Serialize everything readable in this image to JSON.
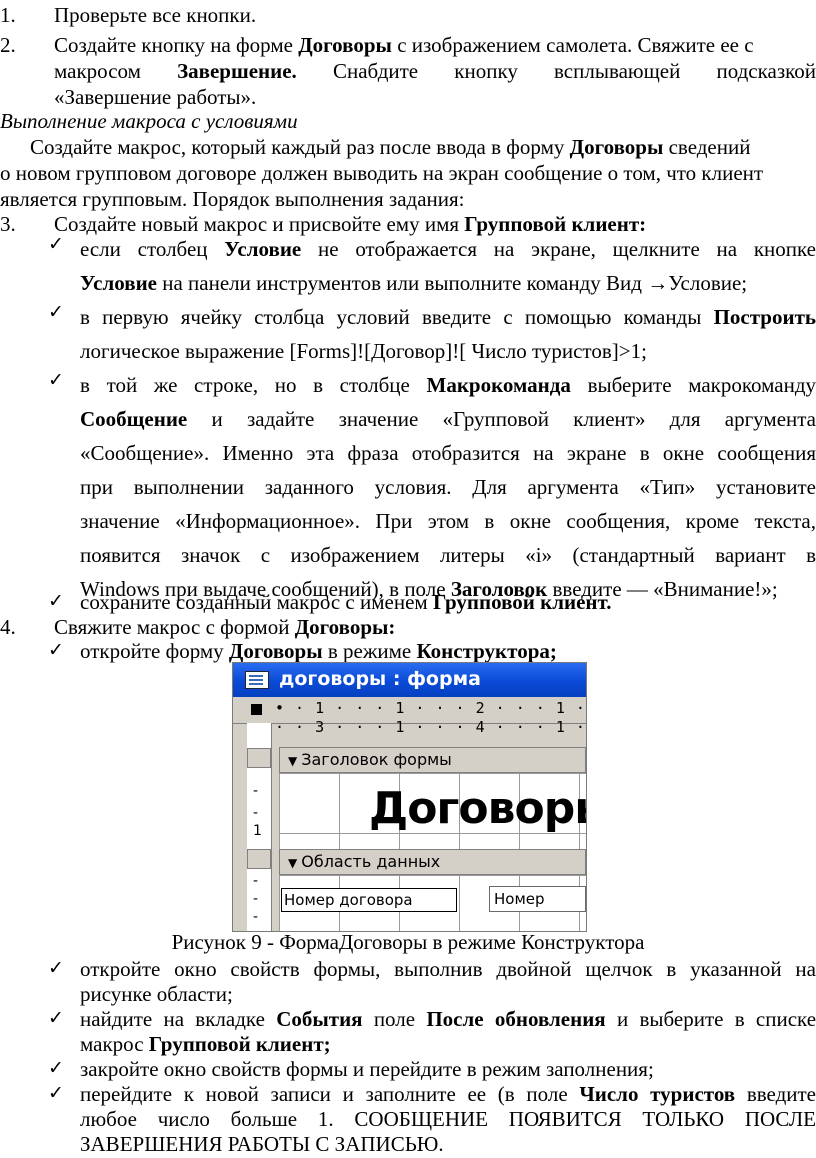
{
  "steps": [
    {
      "num": "1.",
      "text": "Проверьте все кнопки."
    },
    {
      "num": "2.",
      "l1_a": "Создайте кнопку на форме ",
      "l1_b": "Договоры",
      "l1_c": " с изображением самолета. Свяжите ее с",
      "l2_a": "макросом ",
      "l2_b": "Завершение.",
      "l2_c": " Снабдите кнопку всплывающей подсказкой",
      "l3": "«Завершение работы»."
    }
  ],
  "section_title": "Выполнение макроса с условиями",
  "intro": {
    "l1_a": "Создайте макрос, который каждый раз после ввода в форму ",
    "l1_b": "Договоры",
    "l1_c": " сведений",
    "l2": "о новом групповом договоре должен выводить на экран сообщение о том, что клиент",
    "l3": "является групповым. Порядок выполнения задания:"
  },
  "step3": {
    "num": "3.",
    "text_a": "Создайте новый макрос и присвойте ему имя ",
    "text_b": "Групповой клиент:",
    "b1": {
      "l1_a": "если столбец ",
      "l1_b": "Условие",
      "l1_c": " не отображается на экране, щелкните на кнопке",
      "l2_a": "Условие",
      "l2_c": " на панели инструментов или выполните команду Вид →Условие;"
    },
    "b2": {
      "l1_a": "в первую ячейку столбца условий введите с помощью команды ",
      "l1_b": "Построить",
      "l2": "логическое выражение [Forms]![Договор]![ Число туристов]>1;"
    },
    "b3": {
      "l1_a": "в той же строке, но в столбце ",
      "l1_b": "Макрокоманда",
      "l1_c": " выберите макрокоманду",
      "l2_b": "Сообщение",
      "l2_c": " и задайте значение «Групповой клиент» для аргумента",
      "l3": "«Сообщение». Именно эта фраза отобразится на экране в окне сообщения",
      "l4": "при выполнении заданного условия. Для аргумента «Тип» установите",
      "l5": "значение «Информационное». При этом в окне сообщения, кроме текста,",
      "l6": "появится значок с изображением литеры «i» (стандартный вариант в",
      "l7_a": "Windows при выдаче сообщений), в поле ",
      "l7_b": "Заголовок",
      "l7_c": " введите — «Внимание!»;"
    },
    "b4": {
      "a": "сохраните созданный макрос с именем ",
      "b": "Групповой клиент."
    }
  },
  "step4": {
    "num": "4.",
    "text_a": "Свяжите макрос с формой ",
    "text_b": "Договоры:",
    "b1": {
      "a": "откройте форму ",
      "b": "Договоры",
      "c": " в режиме ",
      "d": "Конструктора;"
    }
  },
  "screenshot": {
    "window_title": "договоры : форма",
    "ruler": "• · 1 · · · 1 · · · 2 · · · 1 · · · 3 · · · 1 · · · 4 · · · 1 ·",
    "band_header": "Заголовок формы",
    "band_detail": "Область данных",
    "form_heading": "Договоры",
    "label_text": "Номер договора",
    "field_text": "Номер",
    "ruler_left_mark": "1"
  },
  "caption": "Рисунок 9 - ФормаДоговоры в режиме Конструктора",
  "after": {
    "b1": {
      "l1": "откройте окно свойств формы, выполнив двойной щелчок в указанной на",
      "l2": "рисунке области;"
    },
    "b2": {
      "l1_a": "найдите на вкладке ",
      "l1_b": "События",
      "l1_c": " поле ",
      "l1_d": "После обновления",
      "l1_e": " и выберите в списке",
      "l2_a": "макрос ",
      "l2_b": "Групповой клиент;"
    },
    "b3": {
      "l1": "закройте окно свойств формы и перейдите в режим заполнения;"
    },
    "b4": {
      "l1_a": "перейдите к новой записи и заполните ее (в поле ",
      "l1_b": "Число туристов",
      "l1_c": " введите",
      "l2": "любое число больше 1. СООБЩЕНИЕ ПОЯВИТСЯ ТОЛЬКО ПОСЛЕ",
      "l3": "ЗАВЕРШЕНИЯ РАБОТЫ С ЗАПИСЬЮ."
    }
  },
  "check_icon": "✓"
}
